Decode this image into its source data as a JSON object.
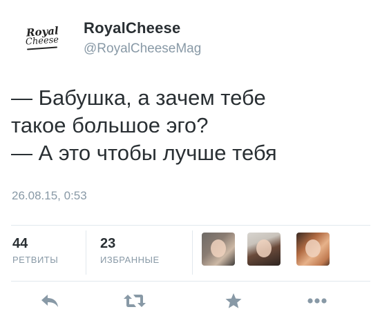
{
  "author": {
    "logo_line1": "Royal",
    "logo_line2": "Cheese",
    "display_name": "RoyalCheese",
    "handle": "@RoyalCheeseMag"
  },
  "tweet": {
    "lines": [
      "— Бабушка, а зачем тебе",
      "такое большое эго?",
      "— А это чтобы лучше тебя"
    ],
    "timestamp": "26.08.15, 0:53"
  },
  "stats": {
    "retweets_count": "44",
    "retweets_label": "РЕТВИТЫ",
    "favorites_count": "23",
    "favorites_label": "ИЗБРАННЫЕ"
  },
  "favorited_by_avatars": [
    "user-avatar",
    "user-avatar",
    "user-avatar"
  ],
  "actions": {
    "reply_icon": "reply-icon",
    "retweet_icon": "retweet-icon",
    "favorite_icon": "star-icon",
    "more_icon": "ellipsis-icon"
  },
  "colors": {
    "text": "#292f33",
    "muted": "#8899a6",
    "divider": "#e1e8ed",
    "icon": "#8899a6"
  }
}
